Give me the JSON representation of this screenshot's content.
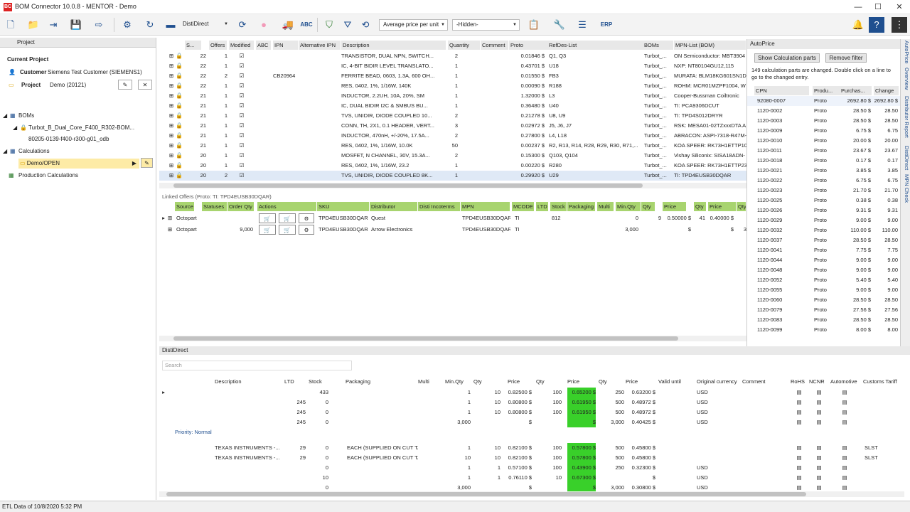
{
  "window": {
    "title": "BOM Connector 10.0.8 - MENTOR - Demo",
    "logo": "BC",
    "minimize": "—",
    "maximize": "☐",
    "close": "✕"
  },
  "toolbar": {
    "disti_select": "DistiDirect",
    "price_select": "Average price per unit",
    "hidden_select": "-Hidden-",
    "abc_label": "ABC",
    "erp_label": "ERP"
  },
  "project_panel": {
    "title": "Project",
    "current_project": "Current Project",
    "customer_label": "Customer",
    "customer_value": "Siemens Test Customer (SIEMENS1)",
    "project_label": "Project",
    "project_value": "Demo (20121)",
    "boms": "BOMs",
    "bom_item": "Turbot_B_Dual_Core_F400_R302-BOM...",
    "bom_sub": "80205-0139-f400-r300-g01_odb",
    "calculations": "Calculations",
    "calc_item": "Demo/OPEN",
    "production": "Production Calculations"
  },
  "bom_grid": {
    "headers": [
      "S...",
      "Offers",
      "Modified",
      "ABC",
      "IPN",
      "Alternative IPN",
      "Description",
      "Quantity",
      "Comment",
      "Proto",
      "RefDes-List",
      "BOMs",
      "MPN-List (BOM)"
    ],
    "rows": [
      {
        "s": "22",
        "offers": "1",
        "ipn": "",
        "desc": "TRANSISTOR, DUAL NPN, SWITCH...",
        "qty": "2",
        "proto": "0.01846 $",
        "ref": "Q1, Q3",
        "boms": "Turbot_...",
        "mpn": "ON Semiconductor: MBT3904"
      },
      {
        "s": "22",
        "offers": "1",
        "ipn": "",
        "desc": "IC, 4-BIT BIDIR LEVEL TRANSLATO...",
        "qty": "1",
        "proto": "0.43701 $",
        "ref": "U18",
        "boms": "Turbot_...",
        "mpn": "NXP: NT80104GU12,115"
      },
      {
        "s": "22",
        "offers": "2",
        "ipn": "CB20964",
        "desc": "FERRITE BEAD, 0603, 1.3A, 600 OH...",
        "qty": "1",
        "proto": "0.01550 $",
        "ref": "FB3",
        "boms": "Turbot_...",
        "mpn": "MURATA: BLM18KG601SN1D"
      },
      {
        "s": "22",
        "offers": "1",
        "ipn": "",
        "desc": "RES, 0402, 1%, 1/16W, 140K",
        "qty": "1",
        "proto": "0.00090 $",
        "ref": "R188",
        "boms": "Turbot_...",
        "mpn": "ROHM: MCR01MZPF1004, W"
      },
      {
        "s": "21",
        "offers": "1",
        "ipn": "",
        "desc": "INDUCTOR, 2.2UH, 10A, 20%, SM",
        "qty": "1",
        "proto": "1.32000 $",
        "ref": "L3",
        "boms": "Turbot_...",
        "mpn": "Cooper-Bussman Coiltronic"
      },
      {
        "s": "21",
        "offers": "1",
        "ipn": "",
        "desc": "IC, DUAL BIDIR I2C & SMBUS BU...",
        "qty": "1",
        "proto": "0.36480 $",
        "ref": "U40",
        "boms": "Turbot_...",
        "mpn": "TI: PCA9306DCUT"
      },
      {
        "s": "21",
        "offers": "1",
        "ipn": "",
        "desc": "TVS, UNIDIR, DIODE COUPLED 10...",
        "qty": "2",
        "proto": "0.21278 $",
        "ref": "U8, U9",
        "boms": "Turbot_...",
        "mpn": "TI: TPD4S012DRYR"
      },
      {
        "s": "21",
        "offers": "1",
        "ipn": "",
        "desc": "CONN, TH, 2X1, 0.1 HEADER, VERT...",
        "qty": "3",
        "proto": "0.02972 $",
        "ref": "J5, J6, J7",
        "boms": "Turbot_...",
        "mpn": "RSK: MESA01-02TZxxxDTA A"
      },
      {
        "s": "21",
        "offers": "1",
        "ipn": "",
        "desc": "INDUCTOR, 470nH, +/-20%, 17.5A...",
        "qty": "2",
        "proto": "0.27800 $",
        "ref": "L4, L18",
        "boms": "Turbot_...",
        "mpn": "ABRACON: ASPI-7318-R47M-"
      },
      {
        "s": "21",
        "offers": "1",
        "ipn": "",
        "desc": "RES, 0402, 1%, 1/16W, 10.0K",
        "qty": "50",
        "proto": "0.00237 $",
        "ref": "R2, R13, R14, R28, R29, R30, R71,...",
        "boms": "Turbot_...",
        "mpn": "KOA SPEER: RK73H1ETTP100"
      },
      {
        "s": "20",
        "offers": "1",
        "ipn": "",
        "desc": "MOSFET, N CHANNEL, 30V, 15.3A...",
        "qty": "2",
        "proto": "0.15300 $",
        "ref": "Q103, Q104",
        "boms": "Turbot_...",
        "mpn": "Vishay Siliconix: SISA18ADN-"
      },
      {
        "s": "20",
        "offers": "1",
        "ipn": "",
        "desc": "RES, 0402, 1%, 1/16W, 23.2",
        "qty": "1",
        "proto": "0.00220 $",
        "ref": "R280",
        "boms": "Turbot_...",
        "mpn": "KOA SPEER: RK73H1ETTP23R"
      },
      {
        "s": "20",
        "offers": "2",
        "ipn": "",
        "desc": "TVS, UNIDIR, DIODE COUPLED 8K...",
        "qty": "1",
        "proto": "0.29920 $",
        "ref": "U29",
        "boms": "Turbot_...",
        "mpn": "TI: TPD4EUSB30DQAR"
      }
    ]
  },
  "linked_offers": {
    "title": "Linked Offers (Proto: TI: TPD4EUSB30DQAR)",
    "headers": [
      "Source",
      "Statuses",
      "Order Qty",
      "Actions",
      "SKU",
      "Distributor",
      "Disti Incoterms",
      "MPN",
      "MCODE",
      "LTD",
      "Stock",
      "Packaging",
      "Multi",
      "Min.Qty",
      "Qty",
      "Price",
      "Qty",
      "Price",
      "Qty"
    ],
    "rows": [
      {
        "source": "Octopart",
        "order_qty": "",
        "sku": "TPD4EUSB30DQAR",
        "dist": "Quest",
        "mpn": "TPD4EUSB30DQAR",
        "mcode": "TI",
        "stock": "812",
        "minqty": "0",
        "qty": "9",
        "price": "0.50000 $",
        "qty2": "41",
        "price2": "0.40000 $"
      },
      {
        "source": "Octopart",
        "order_qty": "9,000",
        "sku": "TPD4EUSB30DQAR",
        "dist": "Arrow Electronics",
        "mpn": "TPD4EUSB30DQAR",
        "mcode": "TI",
        "stock": "",
        "minqty": "3,000",
        "qty": "",
        "price": "$",
        "qty2": "",
        "price2": "$",
        "qty3": "3"
      }
    ]
  },
  "autoprice": {
    "title": "AutoPrice",
    "show_btn": "Show Calculation parts",
    "remove_btn": "Remove filter",
    "message": "149 calculation parts are changed. Double click on a line to go to the changed entry.",
    "headers": [
      "CPN",
      "Produ...",
      "Purchas...",
      "Change"
    ],
    "rows": [
      [
        "92080-0007",
        "Proto",
        "2692.80 $",
        "2692.80 $"
      ],
      [
        "1120-0002",
        "Proto",
        "28.50 $",
        "28.50"
      ],
      [
        "1120-0003",
        "Proto",
        "28.50 $",
        "28.50"
      ],
      [
        "1120-0009",
        "Proto",
        "6.75 $",
        "6.75"
      ],
      [
        "1120-0010",
        "Proto",
        "20.00 $",
        "20.00"
      ],
      [
        "1120-0011",
        "Proto",
        "23.67 $",
        "23.67"
      ],
      [
        "1120-0018",
        "Proto",
        "0.17 $",
        "0.17"
      ],
      [
        "1120-0021",
        "Proto",
        "3.85 $",
        "3.85"
      ],
      [
        "1120-0022",
        "Proto",
        "6.75 $",
        "6.75"
      ],
      [
        "1120-0023",
        "Proto",
        "21.70 $",
        "21.70"
      ],
      [
        "1120-0025",
        "Proto",
        "0.38 $",
        "0.38"
      ],
      [
        "1120-0026",
        "Proto",
        "9.31 $",
        "9.31"
      ],
      [
        "1120-0029",
        "Proto",
        "9.00 $",
        "9.00"
      ],
      [
        "1120-0032",
        "Proto",
        "110.00 $",
        "110.00"
      ],
      [
        "1120-0037",
        "Proto",
        "28.50 $",
        "28.50"
      ],
      [
        "1120-0041",
        "Proto",
        "7.75 $",
        "7.75"
      ],
      [
        "1120-0044",
        "Proto",
        "9.00 $",
        "9.00"
      ],
      [
        "1120-0048",
        "Proto",
        "9.00 $",
        "9.00"
      ],
      [
        "1120-0052",
        "Proto",
        "5.40 $",
        "5.40"
      ],
      [
        "1120-0055",
        "Proto",
        "9.00 $",
        "9.00"
      ],
      [
        "1120-0060",
        "Proto",
        "28.50 $",
        "28.50"
      ],
      [
        "1120-0079",
        "Proto",
        "27.56 $",
        "27.56"
      ],
      [
        "1120-0083",
        "Proto",
        "28.50 $",
        "28.50"
      ],
      [
        "1120-0099",
        "Proto",
        "8.00 $",
        "8.00"
      ]
    ],
    "side_tabs": [
      "AutoPrice",
      "Overview",
      "Distributor Report",
      "DistiDirect",
      "MPN Check"
    ]
  },
  "distidirect": {
    "title": "DistiDirect",
    "search_placeholder": "Search",
    "headers": [
      "Description",
      "LTD",
      "Stock",
      "Packaging",
      "Multi",
      "Min.Qty",
      "Qty",
      "Price",
      "Qty",
      "Price",
      "Qty",
      "Price",
      "Valid until",
      "Original currency",
      "Comment",
      "RoHS",
      "NCNR",
      "Automotive",
      "Customs Tariff"
    ],
    "group_label": "Priority: Normal",
    "rows": [
      {
        "desc": "",
        "ltd": "",
        "stock": "433",
        "pack": "",
        "minqty": "1",
        "q1": "10",
        "p1": "0.82500 $",
        "q2": "100",
        "p2": "0.65200 $",
        "q3": "250",
        "p3": "0.63200 $",
        "cur": "USD",
        "tariff": ""
      },
      {
        "desc": "",
        "ltd": "245",
        "stock": "0",
        "pack": "",
        "minqty": "1",
        "q1": "10",
        "p1": "0.80800 $",
        "q2": "100",
        "p2": "0.61950 $",
        "q3": "500",
        "p3": "0.48972 $",
        "cur": "USD",
        "tariff": ""
      },
      {
        "desc": "",
        "ltd": "245",
        "stock": "0",
        "pack": "",
        "minqty": "1",
        "q1": "10",
        "p1": "0.80800 $",
        "q2": "100",
        "p2": "0.61950 $",
        "q3": "500",
        "p3": "0.48972 $",
        "cur": "USD",
        "tariff": ""
      },
      {
        "desc": "",
        "ltd": "245",
        "stock": "0",
        "pack": "",
        "minqty": "3,000",
        "q1": "",
        "p1": "$",
        "q2": "",
        "p2": "$",
        "q3": "3,000",
        "p3": "0.40425 $",
        "cur": "USD",
        "tariff": ""
      },
      {
        "desc": "TEXAS INSTRUMENTS -...",
        "ltd": "29",
        "stock": "0",
        "pack": "EACH (SUPPLIED ON CUT TAPE)",
        "minqty": "1",
        "q1": "10",
        "p1": "0.82100 $",
        "q2": "100",
        "p2": "0.57800 $",
        "q3": "500",
        "p3": "0.45800 $",
        "cur": "",
        "tariff": "SLST"
      },
      {
        "desc": "TEXAS INSTRUMENTS -...",
        "ltd": "29",
        "stock": "0",
        "pack": "EACH (SUPPLIED ON CUT TAPE)",
        "minqty": "10",
        "q1": "10",
        "p1": "0.82100 $",
        "q2": "100",
        "p2": "0.57800 $",
        "q3": "500",
        "p3": "0.45800 $",
        "cur": "",
        "tariff": "SLST"
      },
      {
        "desc": "",
        "ltd": "",
        "stock": "0",
        "pack": "",
        "minqty": "1",
        "q1": "1",
        "p1": "0.57100 $",
        "q2": "100",
        "p2": "0.43900 $",
        "q3": "250",
        "p3": "0.32300 $",
        "cur": "USD",
        "tariff": ""
      },
      {
        "desc": "",
        "ltd": "",
        "stock": "10",
        "pack": "",
        "minqty": "1",
        "q1": "1",
        "p1": "0.76110 $",
        "q2": "10",
        "p2": "0.67300 $",
        "q3": "",
        "p3": "$",
        "cur": "USD",
        "tariff": ""
      },
      {
        "desc": "",
        "ltd": "",
        "stock": "0",
        "pack": "",
        "minqty": "3,000",
        "q1": "",
        "p1": "$",
        "q2": "",
        "p2": "$",
        "q3": "3,000",
        "p3": "0.30800 $",
        "cur": "USD",
        "tariff": ""
      }
    ]
  },
  "statusbar": {
    "text": "ETL Data of 10/8/2020 5:32 PM"
  },
  "colors": {
    "accent": "#1f4f8f",
    "green_cell": "#39d02a",
    "selected": "#fdeba6"
  }
}
